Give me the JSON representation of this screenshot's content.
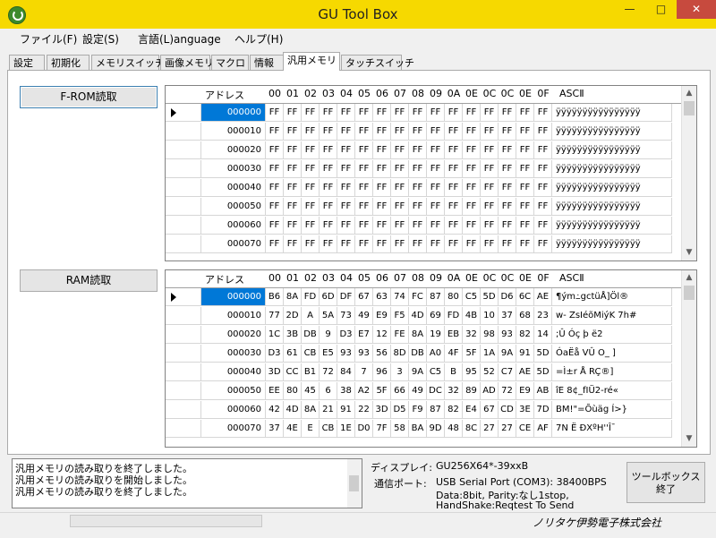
{
  "window": {
    "title": "GU Tool Box",
    "min": "—",
    "max": "□",
    "close": "✕"
  },
  "menu": [
    "ファイル(F)",
    "設定(S)",
    "言語(L)anguage",
    "ヘルプ(H)"
  ],
  "tabs": [
    "設定",
    "初期化",
    "メモリスイッチ",
    "画像メモリ",
    "マクロ",
    "情報",
    "汎用メモリ",
    "タッチスイッチ"
  ],
  "active_tab": "汎用メモリ",
  "buttons": {
    "from_read": "F-ROM読取",
    "ram_read": "RAM読取",
    "exit": "ツールボックス\n終了"
  },
  "grid_header": {
    "addr": "アドレス",
    "cols": [
      "00",
      "01",
      "02",
      "03",
      "04",
      "05",
      "06",
      "07",
      "08",
      "09",
      "0A",
      "0E",
      "0C",
      "0C",
      "0E",
      "0F"
    ],
    "ascii": "ASCⅡ"
  },
  "from_rows": [
    {
      "addr": "000000",
      "hex": [
        "FF",
        "FF",
        "FF",
        "FF",
        "FF",
        "FF",
        "FF",
        "FF",
        "FF",
        "FF",
        "FF",
        "FF",
        "FF",
        "FF",
        "FF",
        "FF"
      ],
      "ascii": "ÿÿÿÿÿÿÿÿÿÿÿÿÿÿÿÿ"
    },
    {
      "addr": "000010",
      "hex": [
        "FF",
        "FF",
        "FF",
        "FF",
        "FF",
        "FF",
        "FF",
        "FF",
        "FF",
        "FF",
        "FF",
        "FF",
        "FF",
        "FF",
        "FF",
        "FF"
      ],
      "ascii": "ÿÿÿÿÿÿÿÿÿÿÿÿÿÿÿÿ"
    },
    {
      "addr": "000020",
      "hex": [
        "FF",
        "FF",
        "FF",
        "FF",
        "FF",
        "FF",
        "FF",
        "FF",
        "FF",
        "FF",
        "FF",
        "FF",
        "FF",
        "FF",
        "FF",
        "FF"
      ],
      "ascii": "ÿÿÿÿÿÿÿÿÿÿÿÿÿÿÿÿ"
    },
    {
      "addr": "000030",
      "hex": [
        "FF",
        "FF",
        "FF",
        "FF",
        "FF",
        "FF",
        "FF",
        "FF",
        "FF",
        "FF",
        "FF",
        "FF",
        "FF",
        "FF",
        "FF",
        "FF"
      ],
      "ascii": "ÿÿÿÿÿÿÿÿÿÿÿÿÿÿÿÿ"
    },
    {
      "addr": "000040",
      "hex": [
        "FF",
        "FF",
        "FF",
        "FF",
        "FF",
        "FF",
        "FF",
        "FF",
        "FF",
        "FF",
        "FF",
        "FF",
        "FF",
        "FF",
        "FF",
        "FF"
      ],
      "ascii": "ÿÿÿÿÿÿÿÿÿÿÿÿÿÿÿÿ"
    },
    {
      "addr": "000050",
      "hex": [
        "FF",
        "FF",
        "FF",
        "FF",
        "FF",
        "FF",
        "FF",
        "FF",
        "FF",
        "FF",
        "FF",
        "FF",
        "FF",
        "FF",
        "FF",
        "FF"
      ],
      "ascii": "ÿÿÿÿÿÿÿÿÿÿÿÿÿÿÿÿ"
    },
    {
      "addr": "000060",
      "hex": [
        "FF",
        "FF",
        "FF",
        "FF",
        "FF",
        "FF",
        "FF",
        "FF",
        "FF",
        "FF",
        "FF",
        "FF",
        "FF",
        "FF",
        "FF",
        "FF"
      ],
      "ascii": "ÿÿÿÿÿÿÿÿÿÿÿÿÿÿÿÿ"
    },
    {
      "addr": "000070",
      "hex": [
        "FF",
        "FF",
        "FF",
        "FF",
        "FF",
        "FF",
        "FF",
        "FF",
        "FF",
        "FF",
        "FF",
        "FF",
        "FF",
        "FF",
        "FF",
        "FF"
      ],
      "ascii": "ÿÿÿÿÿÿÿÿÿÿÿÿÿÿÿÿ"
    }
  ],
  "ram_rows": [
    {
      "addr": "000000",
      "hex": [
        "B6",
        "8A",
        "FD",
        "6D",
        "DF",
        "67",
        "63",
        "74",
        "FC",
        "87",
        "80",
        "C5",
        "5D",
        "D6",
        "6C",
        "AE"
      ],
      "ascii": "¶ým߸gctüÅ]Öl®"
    },
    {
      "addr": "000010",
      "hex": [
        "77",
        "2D",
        "A",
        "5A",
        "73",
        "49",
        "E9",
        "F5",
        "4D",
        "69",
        "FD",
        "4B",
        "10",
        "37",
        "68",
        "23"
      ],
      "ascii": "w- ZsIéõMiýK 7h#"
    },
    {
      "addr": "000020",
      "hex": [
        "1C",
        "3B",
        "DB",
        "9",
        "D3",
        "E7",
        "12",
        "FE",
        "8A",
        "19",
        "EB",
        "32",
        "98",
        "93",
        "82",
        "14"
      ],
      "ascii": " ;Û Óç þ ë2"
    },
    {
      "addr": "000030",
      "hex": [
        "D3",
        "61",
        "CB",
        "E5",
        "93",
        "93",
        "56",
        "8D",
        "DB",
        "A0",
        "4F",
        "5F",
        "1A",
        "9A",
        "91",
        "5D"
      ],
      "ascii": "ÓaËå VÛ O_ ]"
    },
    {
      "addr": "000040",
      "hex": [
        "3D",
        "CC",
        "B1",
        "72",
        "84",
        "7",
        "96",
        "3",
        "9A",
        "C5",
        "B",
        "95",
        "52",
        "C7",
        "AE",
        "5D"
      ],
      "ascii": "=Ì±r  Å RÇ®]"
    },
    {
      "addr": "000050",
      "hex": [
        "EE",
        "80",
        "45",
        "6",
        "38",
        "A2",
        "5F",
        "66",
        "49",
        "DC",
        "32",
        "89",
        "AD",
        "72",
        "E9",
        "AB"
      ],
      "ascii": "îE 8¢_fIÜ2-ré«"
    },
    {
      "addr": "000060",
      "hex": [
        "42",
        "4D",
        "8A",
        "21",
        "91",
        "22",
        "3D",
        "D5",
        "F9",
        "87",
        "82",
        "E4",
        "67",
        "CD",
        "3E",
        "7D"
      ],
      "ascii": "BM!\"=Õùäg Í>}"
    },
    {
      "addr": "000070",
      "hex": [
        "37",
        "4E",
        "E",
        "CB",
        "1E",
        "D0",
        "7F",
        "58",
        "BA",
        "9D",
        "48",
        "8C",
        "27",
        "27",
        "CE",
        "AF"
      ],
      "ascii": "7N Ë ÐXºH''Î¯"
    }
  ],
  "log": [
    "汎用メモリの読み取りを終了しました。",
    "汎用メモリの読み取りを開始しました。",
    "汎用メモリの読み取りを終了しました。"
  ],
  "status": {
    "display_label": "ディスプレイ:",
    "display_value": "GU256X64*-39xxB",
    "port_label": "通信ポート:",
    "port_value1": "USB Serial Port (COM3):  38400BPS",
    "port_value2": "Data:8bit, Parity:なし1stop,",
    "port_value3": "HandShake:Reqtest To Send"
  },
  "company": "ノリタケ伊勢電子株式会社"
}
